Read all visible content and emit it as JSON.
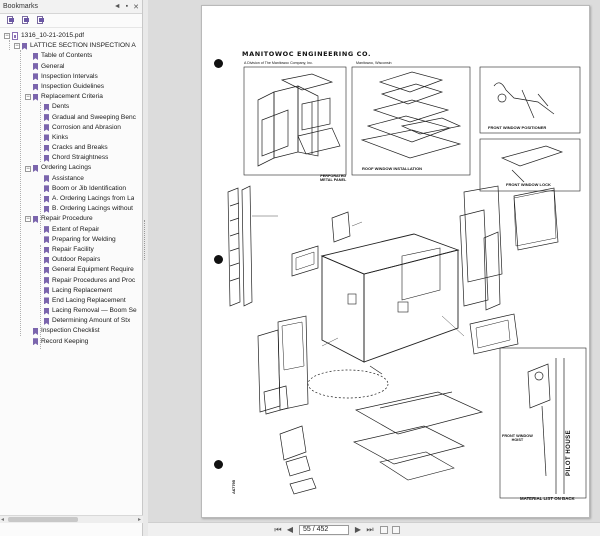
{
  "bookmarks": {
    "title": "Bookmarks",
    "header_controls": [
      "◄",
      "▪",
      "✕"
    ],
    "file_name": "1316_10-21-2015.pdf",
    "items": [
      {
        "label": "LATTICE SECTION INSPECTION A",
        "level": 1,
        "toggle": "−"
      },
      {
        "label": "Table of Contents",
        "level": 2
      },
      {
        "label": "General",
        "level": 2
      },
      {
        "label": "Inspection Intervals",
        "level": 2
      },
      {
        "label": "Inspection Guidelines",
        "level": 2
      },
      {
        "label": "Replacement Criteria",
        "level": 2,
        "toggle": "−"
      },
      {
        "label": "Dents",
        "level": 3
      },
      {
        "label": "Gradual and Sweeping Benc",
        "level": 3
      },
      {
        "label": "Corrosion and Abrasion",
        "level": 3
      },
      {
        "label": "Kinks",
        "level": 3
      },
      {
        "label": "Cracks and Breaks",
        "level": 3
      },
      {
        "label": "Chord Straightness",
        "level": 3
      },
      {
        "label": "Ordering Lacings",
        "level": 2,
        "toggle": "−"
      },
      {
        "label": "Assistance",
        "level": 3
      },
      {
        "label": "Boom or Jib Identification",
        "level": 3
      },
      {
        "label": "A. Ordering Lacings from La",
        "level": 3
      },
      {
        "label": "B. Ordering Lacings without",
        "level": 3
      },
      {
        "label": "Repair Procedure",
        "level": 2,
        "toggle": "−"
      },
      {
        "label": "Extent of Repair",
        "level": 3
      },
      {
        "label": "Preparing for Welding",
        "level": 3
      },
      {
        "label": "Repair Facility",
        "level": 3
      },
      {
        "label": "Outdoor Repairs",
        "level": 3
      },
      {
        "label": "General Equipment Require",
        "level": 3
      },
      {
        "label": "Repair Procedures and Proc",
        "level": 3
      },
      {
        "label": "Lacing Replacement",
        "level": 3
      },
      {
        "label": "End Lacing Replacement",
        "level": 3
      },
      {
        "label": "Lacing Removal — Boom Se",
        "level": 3
      },
      {
        "label": "Determining Amount of Stx",
        "level": 3
      },
      {
        "label": "Inspection Checklist",
        "level": 2
      },
      {
        "label": "Record Keeping",
        "level": 2
      }
    ]
  },
  "document": {
    "company": "MANITOWOC ENGINEERING CO.",
    "subtitle_left": "A Division of The Manitowoc Company, Inc.",
    "subtitle_right": "Manitowoc, Wisconsin",
    "captions": {
      "perforated": "PERFORATED\nMETAL PANEL",
      "roof_window": "ROOF WINDOW INSTALLATION",
      "front_positioner": "FRONT WINDOW POSITIONER",
      "front_lock": "FRONT WINDOW LOCK",
      "front_hoist": "FRONT WINDOW\nHOIST",
      "material_list": "MATERIAL LIST ON BACK",
      "pilot_house": "PILOT HOUSE",
      "doc_number": "A67795"
    }
  },
  "status_bar": {
    "page_display": "55 / 452",
    "first": "⏮",
    "prev": "◀",
    "next": "▶",
    "last": "⏭"
  }
}
